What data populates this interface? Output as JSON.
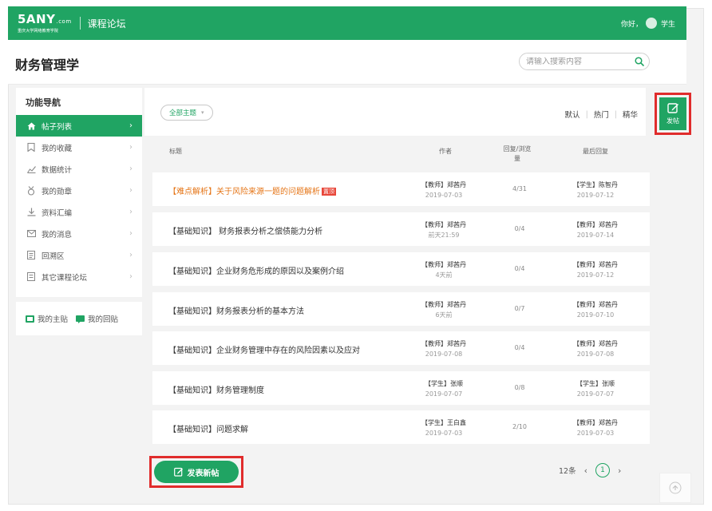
{
  "topbar": {
    "logo_main": "5ANY",
    "logo_suffix": ".com",
    "logo_sub": "重庆大学网络教育学院",
    "course_title": "课程论坛",
    "greeting": "你好，",
    "user_role": "学生"
  },
  "header": {
    "page_title": "财务管理学",
    "search_placeholder": "请输入搜索内容"
  },
  "sidebar": {
    "title": "功能导航",
    "items": [
      {
        "label": "帖子列表",
        "icon": "home-icon"
      },
      {
        "label": "我的收藏",
        "icon": "bookmark-icon"
      },
      {
        "label": "数据统计",
        "icon": "chart-icon"
      },
      {
        "label": "我的勋章",
        "icon": "medal-icon"
      },
      {
        "label": "资料汇编",
        "icon": "download-icon"
      },
      {
        "label": "我的消息",
        "icon": "mail-icon"
      },
      {
        "label": "回溯区",
        "icon": "document-icon"
      },
      {
        "label": "其它课程论坛",
        "icon": "forum-icon"
      }
    ],
    "my_posts": "我的主贴",
    "my_replies": "我的回贴"
  },
  "toolbar": {
    "filter_label": "全部主题",
    "sort_default": "默认",
    "sort_hot": "热门",
    "sort_featured": "精华",
    "post_label": "发帖"
  },
  "columns": {
    "title": "标题",
    "author": "作者",
    "counts": "回复/浏览量",
    "last_reply": "最后回复"
  },
  "posts": [
    {
      "title": "【难点解析】关于风险来源一题的问题解析",
      "badge": "置顶",
      "author": "【教师】郑茜丹",
      "date": "2019-07-03",
      "counts": "4/31",
      "last_name": "【学生】陈智丹",
      "last_date": "2019-07-12"
    },
    {
      "title": "【基础知识】 财务报表分析之偿债能力分析",
      "author": "【教师】郑茜丹",
      "date": "前天21:59",
      "counts": "0/4",
      "last_name": "【教师】郑茜丹",
      "last_date": "2019-07-14"
    },
    {
      "title": "【基础知识】企业财务危形成的原因以及案例介绍",
      "author": "【教师】郑茜丹",
      "date": "4天前",
      "counts": "0/4",
      "last_name": "【教师】郑茜丹",
      "last_date": "2019-07-12"
    },
    {
      "title": "【基础知识】财务报表分析的基本方法",
      "author": "【教师】郑茜丹",
      "date": "6天前",
      "counts": "0/7",
      "last_name": "【教师】郑茜丹",
      "last_date": "2019-07-10"
    },
    {
      "title": "【基础知识】企业财务管理中存在的风险因素以及应对",
      "author": "【教师】郑茜丹",
      "date": "2019-07-08",
      "counts": "0/4",
      "last_name": "【教师】郑茜丹",
      "last_date": "2019-07-08"
    },
    {
      "title": "【基础知识】财务管理制度",
      "author": "【学生】张顺",
      "date": "2019-07-07",
      "counts": "0/8",
      "last_name": "【学生】张顺",
      "last_date": "2019-07-07"
    },
    {
      "title": "【基础知识】问题求解",
      "author": "【学生】王白鑫",
      "date": "2019-07-03",
      "counts": "2/10",
      "last_name": "【教师】郑茜丹",
      "last_date": "2019-07-03"
    }
  ],
  "footer": {
    "new_post_label": "发表新帖",
    "total": "12条",
    "current_page": "1"
  },
  "colors": {
    "brand_green": "#20a463",
    "highlight_red": "#e02c2c",
    "pinned_orange": "#e57517"
  }
}
